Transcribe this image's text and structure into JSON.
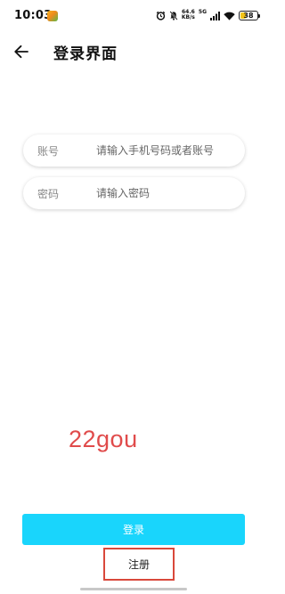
{
  "status_bar": {
    "time": "10:03",
    "net_speed_value": "64.6",
    "net_speed_unit": "KB/s",
    "network_type": "5G",
    "battery_level": "38",
    "battery_fraction": 0.38,
    "icons": [
      "app-notification-icon",
      "alarm-icon",
      "mute-icon",
      "wifi-icon",
      "signal-icon",
      "battery-icon"
    ]
  },
  "header": {
    "back_icon": "arrow-left-icon",
    "title": "登录界面"
  },
  "form": {
    "account_label": "账号",
    "account_placeholder": "请输入手机号码或者账号",
    "password_label": "密码",
    "password_placeholder": "请输入密码"
  },
  "watermark": "22gou",
  "actions": {
    "login_label": "登录",
    "register_label": "注册"
  },
  "colors": {
    "login_button": "#19d5fc",
    "register_highlight": "#d9483b",
    "watermark": "#e04b4b",
    "battery": "#f3c317"
  }
}
